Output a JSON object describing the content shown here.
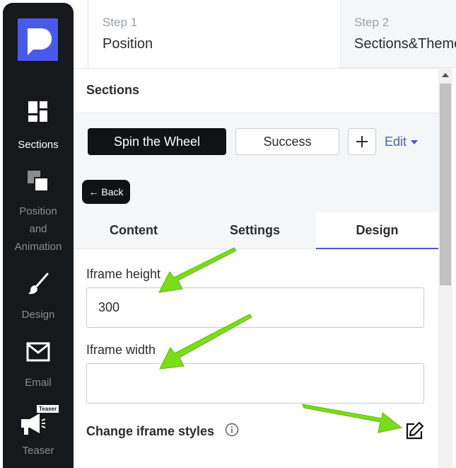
{
  "sidebar": {
    "items": [
      {
        "label": "Sections",
        "icon": "sections-icon"
      },
      {
        "label": "Position and Animation",
        "label_lines": [
          "Position",
          "and",
          "Animation"
        ],
        "icon": "layers-icon"
      },
      {
        "label": "Design",
        "icon": "brush-icon"
      },
      {
        "label": "Email",
        "icon": "envelope-icon"
      },
      {
        "label": "Teaser",
        "icon": "megaphone-icon",
        "badge": "Teaser"
      }
    ],
    "active_index": 0
  },
  "steps": [
    {
      "number": "Step 1",
      "title": "Position"
    },
    {
      "number": "Step 2",
      "title": "Sections&Theme"
    }
  ],
  "panel": {
    "header": "Sections",
    "section_buttons": {
      "spin": "Spin the Wheel",
      "success": "Success",
      "add": "+",
      "edit": "Edit"
    },
    "back_label": "← Back",
    "tabs": [
      "Content",
      "Settings",
      "Design"
    ],
    "active_tab": "Design",
    "fields": {
      "iframe_height": {
        "label": "Iframe height",
        "value": "300"
      },
      "iframe_width": {
        "label": "Iframe width",
        "value": ""
      }
    },
    "change_styles_label": "Change iframe styles"
  },
  "colors": {
    "sidebar_bg": "#17181b",
    "accent": "#4b57d6",
    "logo": "#4a5ae8",
    "annotation_arrow": "#7bdc1a"
  }
}
